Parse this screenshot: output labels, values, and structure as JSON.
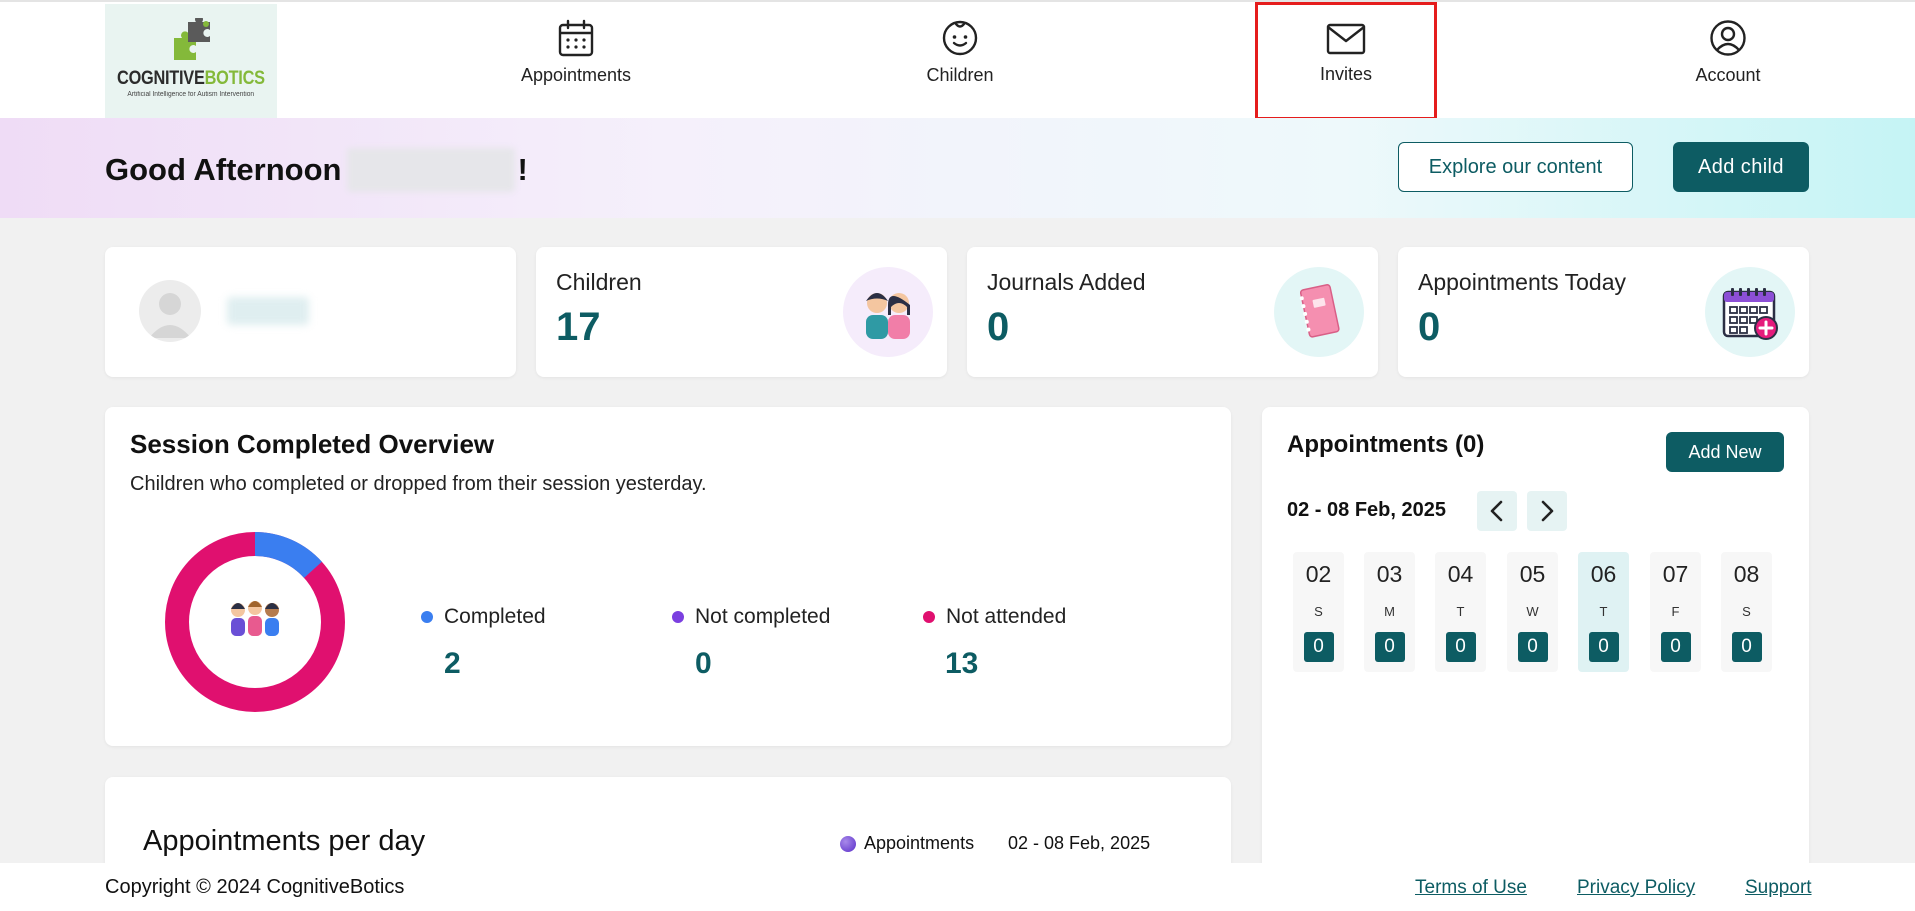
{
  "brand": {
    "name_part1": "COGNITIVE",
    "name_part2": "BOTICS",
    "tagline": "Artificial Intelligence for Autism Intervention"
  },
  "nav": {
    "items": [
      {
        "label": "Appointments",
        "icon": "calendar-icon"
      },
      {
        "label": "Children",
        "icon": "child-face-icon"
      },
      {
        "label": "Invites",
        "icon": "envelope-icon"
      },
      {
        "label": "Account",
        "icon": "user-circle-icon"
      }
    ],
    "highlight_color": "#e51c1c"
  },
  "greeting": {
    "prefix": "Good Afternoon",
    "suffix": "!",
    "explore_button": "Explore our content",
    "add_child_button": "Add child"
  },
  "stats": [
    {
      "title": "Children",
      "value": "17",
      "icon": "children-icon"
    },
    {
      "title": "Journals Added",
      "value": "0",
      "icon": "journal-icon"
    },
    {
      "title": "Appointments Today",
      "value": "0",
      "icon": "calendar-plus-icon"
    }
  ],
  "session_overview": {
    "title": "Session Completed Overview",
    "subtitle": "Children who completed or dropped from their session yesterday.",
    "legend": [
      {
        "label": "Completed",
        "value": "2",
        "color": "#3a7ef0"
      },
      {
        "label": "Not completed",
        "value": "0",
        "color": "#7b3fe0"
      },
      {
        "label": "Not attended",
        "value": "13",
        "color": "#e0106f"
      }
    ]
  },
  "appointments_panel": {
    "title": "Appointments (0)",
    "add_button": "Add New",
    "week_range": "02 - 08 Feb, 2025",
    "days": [
      {
        "num": "02",
        "letter": "S",
        "count": "0"
      },
      {
        "num": "03",
        "letter": "M",
        "count": "0"
      },
      {
        "num": "04",
        "letter": "T",
        "count": "0"
      },
      {
        "num": "05",
        "letter": "W",
        "count": "0"
      },
      {
        "num": "06",
        "letter": "T",
        "count": "0"
      },
      {
        "num": "07",
        "letter": "F",
        "count": "0"
      },
      {
        "num": "08",
        "letter": "S",
        "count": "0"
      }
    ],
    "selected_day": "06"
  },
  "appointments_per_day": {
    "title": "Appointments per day",
    "legend_label": "Appointments",
    "range": "02 - 08 Feb, 2025"
  },
  "footer": {
    "copyright": "Copyright © 2024 CognitiveBotics",
    "links": [
      "Terms of Use",
      "Privacy Policy",
      "Support"
    ]
  },
  "colors": {
    "primary": "#0d5c63",
    "page_background": "#f1f1f1"
  }
}
